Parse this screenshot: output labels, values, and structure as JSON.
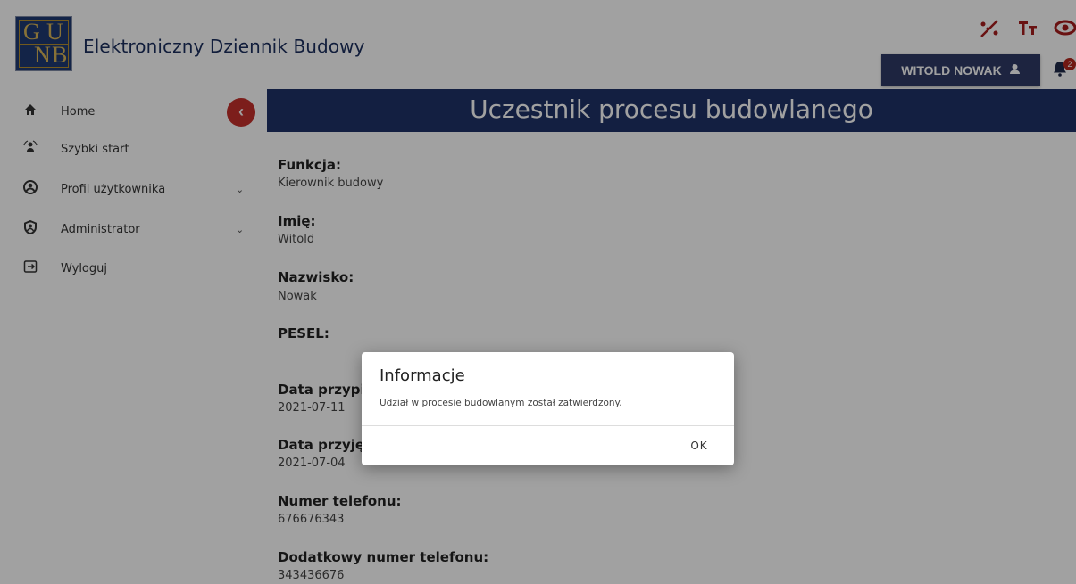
{
  "header": {
    "logo_letters": [
      "G",
      "U",
      "N",
      "B"
    ],
    "app_title": "Elektroniczny Dziennik Budowy",
    "user_button": "WITOLD NOWAK",
    "bell_badge": "2",
    "icons": [
      "contrast-icon",
      "text-size-icon",
      "eye-icon",
      "user-icon",
      "bell-icon"
    ]
  },
  "sidebar": {
    "items": [
      {
        "label": "Home",
        "icon": "home-icon"
      },
      {
        "label": "Szybki start",
        "icon": "quick-start-icon"
      },
      {
        "label": "Profil użytkownika",
        "icon": "user-circle-icon",
        "expandable": true
      },
      {
        "label": "Administrator",
        "icon": "admin-icon",
        "expandable": true
      },
      {
        "label": "Wyloguj",
        "icon": "logout-icon"
      }
    ]
  },
  "main": {
    "title": "Uczestnik procesu budowlanego",
    "fields": [
      {
        "label": "Funkcja:",
        "value": "Kierownik budowy"
      },
      {
        "label": "Imię:",
        "value": "Witold"
      },
      {
        "label": "Nazwisko:",
        "value": "Nowak"
      },
      {
        "label": "PESEL:",
        "value": ""
      },
      {
        "label": "Data przypis",
        "value": "2021-07-11"
      },
      {
        "label": "Data przyję",
        "value": "2021-07-04"
      },
      {
        "label": "Numer telefonu:",
        "value": "676676343"
      },
      {
        "label": "Dodatkowy numer telefonu:",
        "value": "343436676"
      }
    ]
  },
  "dialog": {
    "title": "Informacje",
    "message": "Udział w procesie budowlanym został zatwierdzony.",
    "ok_label": "OK"
  },
  "colors": {
    "brand_navy": "#1f3167",
    "accent_red": "#c4302b",
    "user_button": "#2f3a66"
  }
}
